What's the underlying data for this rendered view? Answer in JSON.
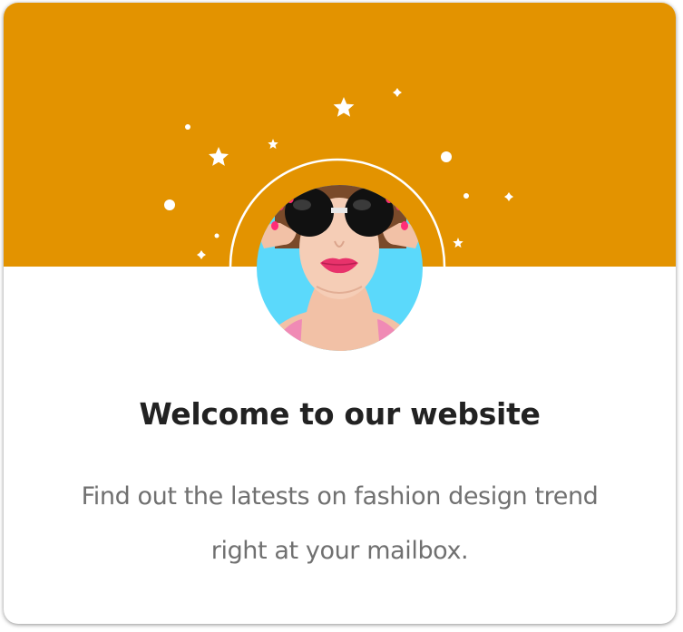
{
  "card": {
    "accent_color": "#E39300",
    "title": "Welcome to our website",
    "description": "Find out the latests on fashion design trend right at your mailbox."
  },
  "hero": {
    "decorations": [
      "star-icon",
      "sparkle-dot-icon",
      "arc-ring"
    ]
  },
  "avatar": {
    "subject": "woman-with-round-sunglasses",
    "background_color": "#5BD9FB"
  }
}
